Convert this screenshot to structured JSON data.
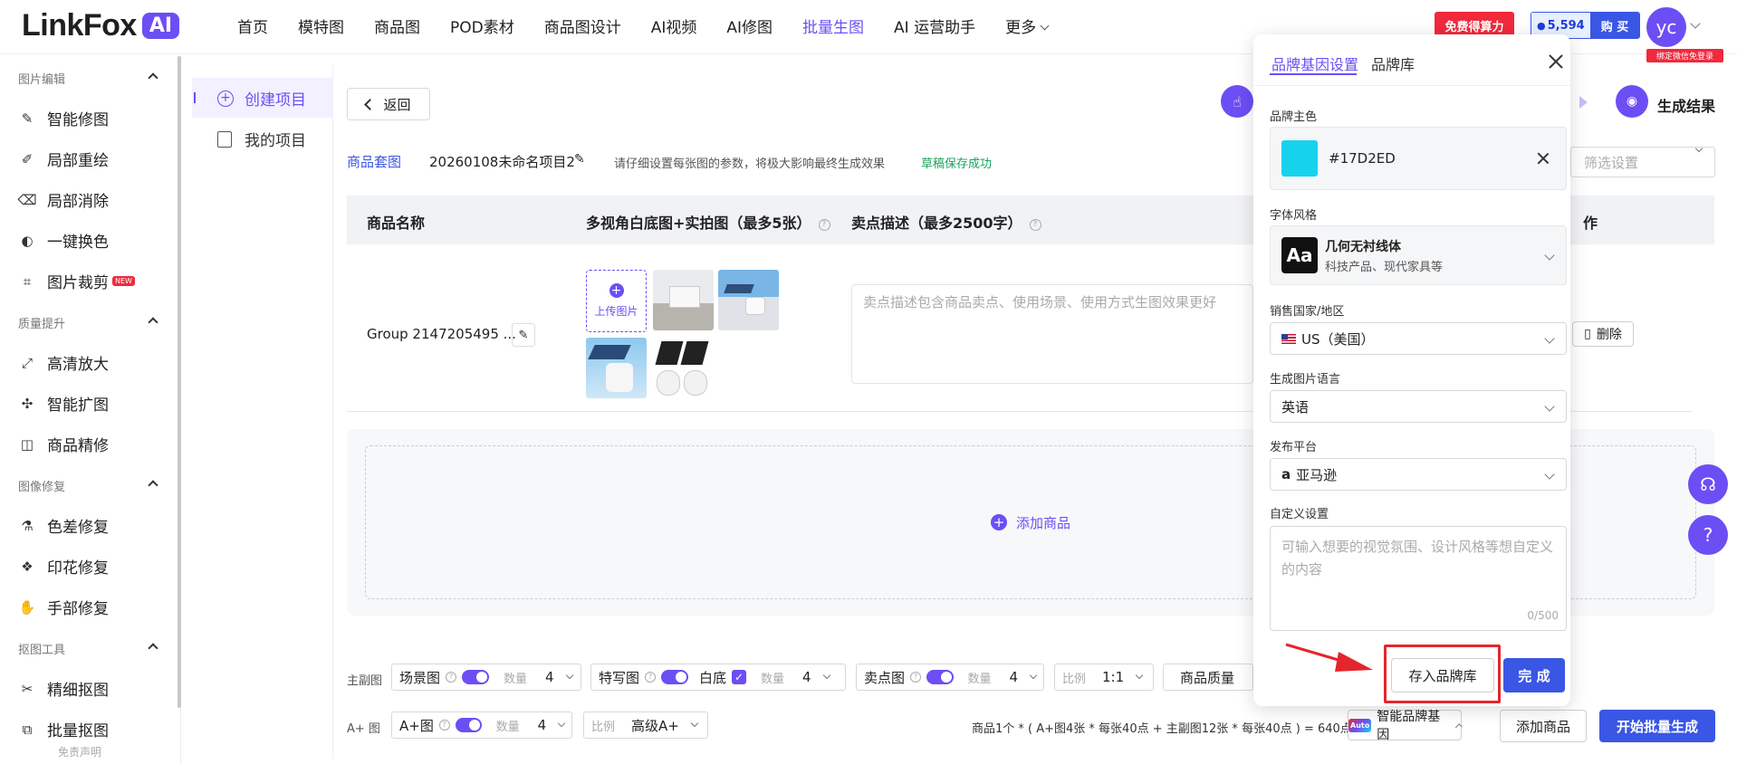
{
  "header": {
    "logo_text": "LinkFox",
    "logo_badge": "AI",
    "nav": [
      "首页",
      "模特图",
      "商品图",
      "POD素材",
      "商品图设计",
      "AI视频",
      "AI修图",
      "批量生图",
      "AI 运营助手",
      "更多"
    ],
    "nav_active": "批量生图",
    "compute_label": "免费得算力",
    "credits": "5,594",
    "buy_label": "购 买",
    "avatar_text": "yc",
    "bind_tag": "绑定微信免登录"
  },
  "sidebar": {
    "sections": [
      {
        "title": "图片编辑",
        "items": [
          "智能修图",
          "局部重绘",
          "局部消除",
          "一键换色",
          "图片裁剪"
        ]
      },
      {
        "title": "质量提升",
        "items": [
          "高清放大",
          "智能扩图",
          "商品精修"
        ]
      },
      {
        "title": "图像修复",
        "items": [
          "色差修复",
          "印花修复",
          "手部修复"
        ]
      },
      {
        "title": "抠图工具",
        "items": [
          "精细抠图",
          "批量抠图"
        ]
      }
    ],
    "new_badge": "NEW",
    "disclaimer": "免责声明"
  },
  "project_nav": {
    "create": "创建项目",
    "mine": "我的项目"
  },
  "toolbar": {
    "back": "返回",
    "result": "生成结果"
  },
  "crumbs": {
    "set": "商品套图",
    "project_name": "20260108未命名项目2",
    "hint": "请仔细设置每张图的参数，将极大影响最终生成效果",
    "saved": "草稿保存成功",
    "filter_placeholder": "筛选设置"
  },
  "table": {
    "headers": [
      "商品名称",
      "多视角白底图+实拍图（最多5张）",
      "卖点描述（最多2500字）",
      "作"
    ],
    "row": {
      "name": "Group 2147205495 ...",
      "upload": "上传图片",
      "desc_placeholder": "卖点描述包含商品卖点、使用场景、使用方式生图效果更好",
      "delete": "删除"
    },
    "add_product": "添加商品"
  },
  "controls": {
    "main_label": "主副图",
    "scene": "场景图",
    "count_label": "数量",
    "scene_count": "4",
    "closeup": "特写图",
    "white": "白底",
    "closeup_count": "4",
    "selling": "卖点图",
    "selling_count": "4",
    "ratio_label": "比例",
    "ratio": "1:1",
    "quality": "商品质量",
    "aplus_label": "A+ 图",
    "aplus": "A+图",
    "aplus_count": "4",
    "aplus_ratio": "高级A+",
    "formula": "商品1个 * ( A+图4张 * 每张40点 + 主副图12张 * 每张40点 ) = 640点",
    "brand_gene": "智能品牌基因",
    "auto_badge": "Auto",
    "add_product_btn": "添加商品",
    "start": "开始批量生成"
  },
  "panel": {
    "tabs": [
      "品牌基因设置",
      "品牌库"
    ],
    "brand_color_label": "品牌主色",
    "brand_color": "#17D2ED",
    "font_label": "字体风格",
    "font_name": "几何无衬线体",
    "font_desc": "科技产品、现代家具等",
    "font_icon": "Aa",
    "country_label": "销售国家/地区",
    "country": "US（美国）",
    "lang_label": "生成图片语言",
    "lang": "英语",
    "platform_label": "发布平台",
    "platform": "亚马逊",
    "custom_label": "自定义设置",
    "custom_placeholder": "可输入想要的视觉氛围、设计风格等想自定义的内容",
    "counter": "0/500",
    "save_brand": "存入品牌库",
    "done": "完 成"
  },
  "colors": {
    "accent": "#6c4ef5",
    "primary_blue": "#3a56e5",
    "brand_color": "#17D2ED",
    "highlight_red": "#e5252e"
  }
}
